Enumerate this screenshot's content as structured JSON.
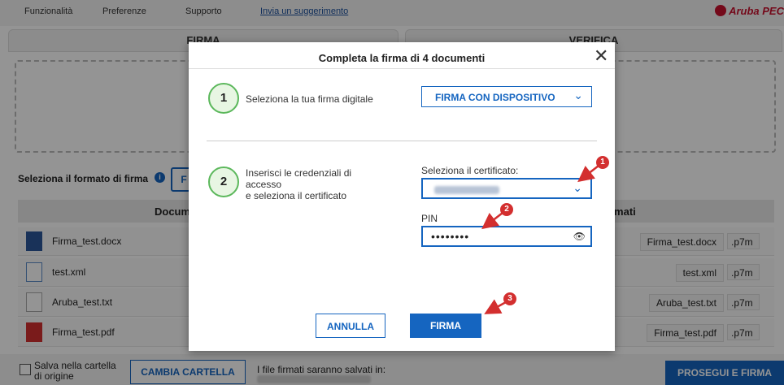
{
  "menubar": {
    "items": [
      "Funzionalità",
      "Preferenze",
      "Supporto"
    ],
    "link": "Invia un suggerimento",
    "brand": "Aruba PEC"
  },
  "tabs": [
    "FIRMA",
    "VERIFICA"
  ],
  "format": {
    "label": "Seleziona il formato di firma",
    "button": "F"
  },
  "table": {
    "headers": [
      "Docum",
      "rmati"
    ],
    "rows": [
      {
        "name": "Firma_test.docx",
        "signed": "Firma_test.docx",
        "ext": ".p7m",
        "icon": "word-file-icon"
      },
      {
        "name": "test.xml",
        "signed": "test.xml",
        "ext": ".p7m",
        "icon": "xml-file-icon"
      },
      {
        "name": "Aruba_test.txt",
        "signed": "Aruba_test.txt",
        "ext": ".p7m",
        "icon": "text-file-icon"
      },
      {
        "name": "Firma_test.pdf",
        "signed": "Firma_test.pdf",
        "ext": ".p7m",
        "icon": "pdf-file-icon"
      }
    ]
  },
  "bottom": {
    "save_checkbox_line1": "Salva nella cartella",
    "save_checkbox_line2": "di origine",
    "change_folder": "CAMBIA CARTELLA",
    "saved_in": "I file firmati saranno salvati in:",
    "proceed": "PROSEGUI E FIRMA"
  },
  "dialog": {
    "title": "Completa la firma di 4 documenti",
    "step1": {
      "number": "1",
      "text": "Seleziona la tua firma digitale",
      "select_value": "FIRMA CON DISPOSITIVO"
    },
    "step2": {
      "number": "2",
      "text_line1": "Inserisci le credenziali di",
      "text_line2": "accesso",
      "text_line3": "e seleziona il certificato",
      "cert_label": "Seleziona il certificato:",
      "pin_label": "PIN",
      "pin_value": "••••••••"
    },
    "cancel": "ANNULLA",
    "sign": "FIRMA",
    "annotations": [
      "1",
      "2",
      "3"
    ]
  },
  "colors": {
    "accent": "#1565c0",
    "step": "#5cb85c",
    "annotation": "#d32f2f",
    "brand": "#c8102e"
  }
}
